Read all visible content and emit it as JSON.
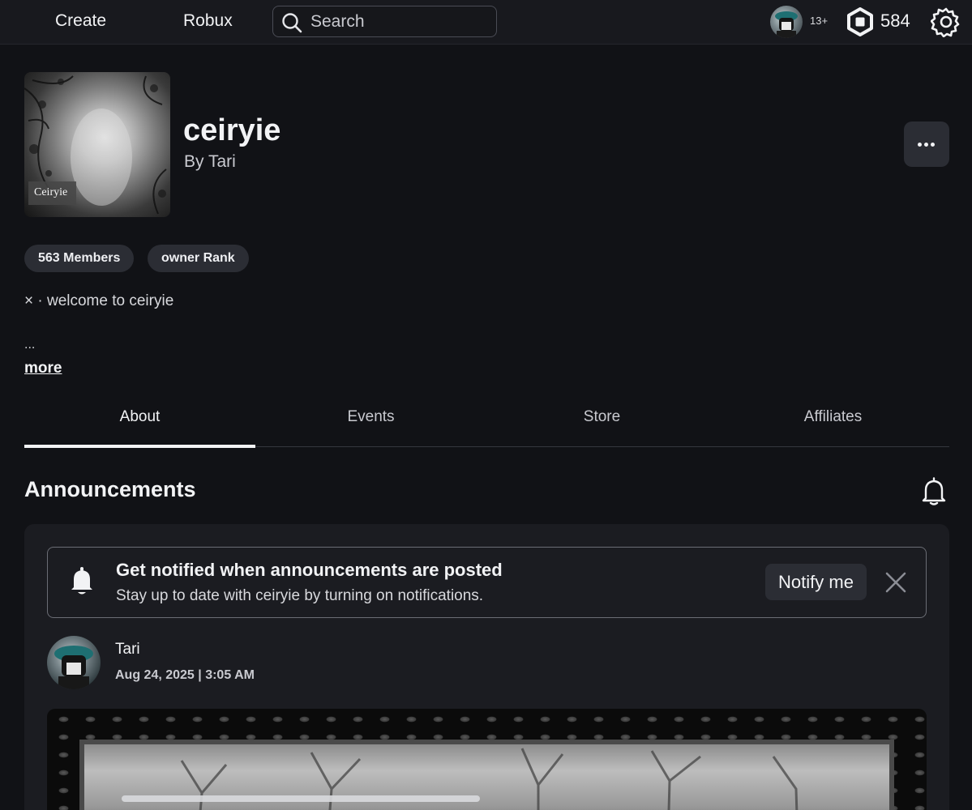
{
  "topbar": {
    "nav": [
      {
        "label": "Create"
      },
      {
        "label": "Robux"
      }
    ],
    "search": {
      "placeholder": "Search",
      "value": ""
    },
    "age_badge": "13+",
    "robux_balance": "584",
    "icons": [
      "search-icon",
      "robux-icon",
      "gear-icon"
    ]
  },
  "group": {
    "emblem_label": "Ceiryie",
    "name": "ceiryie",
    "owner": "By Tari",
    "pills": [
      "563 Members",
      "owner Rank"
    ],
    "description": "× · welcome to ceiryie",
    "ellipsis": "...",
    "more_link": "more"
  },
  "tabs": {
    "items": [
      {
        "label": "About"
      },
      {
        "label": "Events"
      },
      {
        "label": "Store"
      },
      {
        "label": "Affiliates"
      }
    ],
    "active": "About"
  },
  "announcements": {
    "title": "Announcements",
    "notify": {
      "title": "Get notified when announcements are posted",
      "subtitle": "Stay up to date with ceiryie by turning on notifications.",
      "button": "Notify me"
    },
    "post": {
      "author": "Tari",
      "date": "Aug 24, 2025 | 3:05 AM"
    }
  },
  "colors": {
    "background": "#111216",
    "surface": "#1b1c21",
    "pill": "#2b2d34",
    "text": "#f2f3f5",
    "muted": "#c9cad0"
  }
}
